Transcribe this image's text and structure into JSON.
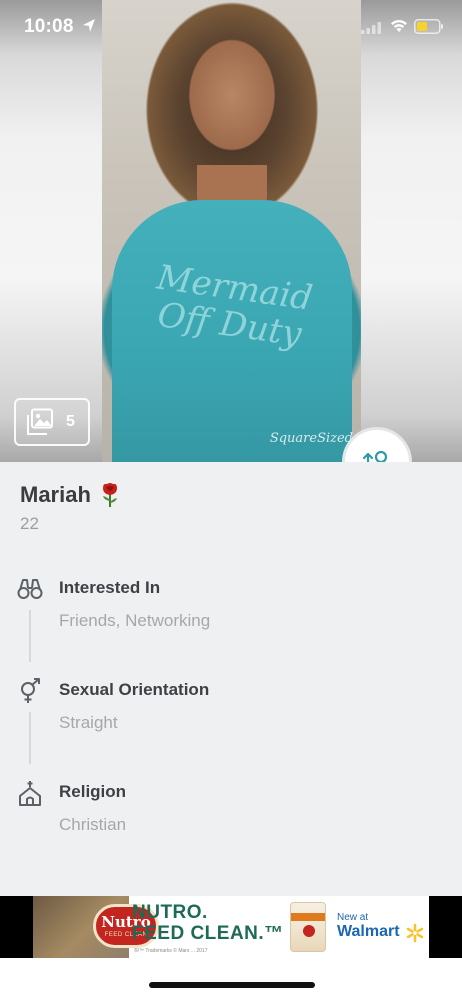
{
  "status_bar": {
    "time": "10:08",
    "icons": [
      "location-arrow-icon",
      "signal-icon",
      "wifi-icon",
      "battery-icon"
    ],
    "battery_color": "#f7d12f"
  },
  "photo": {
    "count": "5",
    "shirt_text": "Mermaid Off Duty",
    "watermark": "SquareSized"
  },
  "profile": {
    "name": "Mariah",
    "age": "22",
    "badge_icon": "rose-icon"
  },
  "attributes": [
    {
      "icon": "binoculars-icon",
      "label": "Interested In",
      "value": "Friends, Networking"
    },
    {
      "icon": "gender-symbol-icon",
      "label": "Sexual Orientation",
      "value": "Straight"
    },
    {
      "icon": "church-icon",
      "label": "Religion",
      "value": "Christian"
    }
  ],
  "ad": {
    "brand": "Nutro",
    "brand_sub": "FEED CLEAN",
    "headline_line1": "NUTRO.",
    "headline_line2": "FEED CLEAN.™",
    "fine_print": "®/™ Trademarks © Mars ...  2017",
    "new_at": "New at",
    "retailer": "Walmart"
  },
  "colors": {
    "accent": "#2f9aa8",
    "panel_background": "#eff0f1",
    "label_text": "#3d4145",
    "secondary_text": "#a4a8ad",
    "ad_headline": "#1d6b57",
    "walmart_blue": "#1b67b2",
    "walmart_spark": "#f7c22c"
  }
}
